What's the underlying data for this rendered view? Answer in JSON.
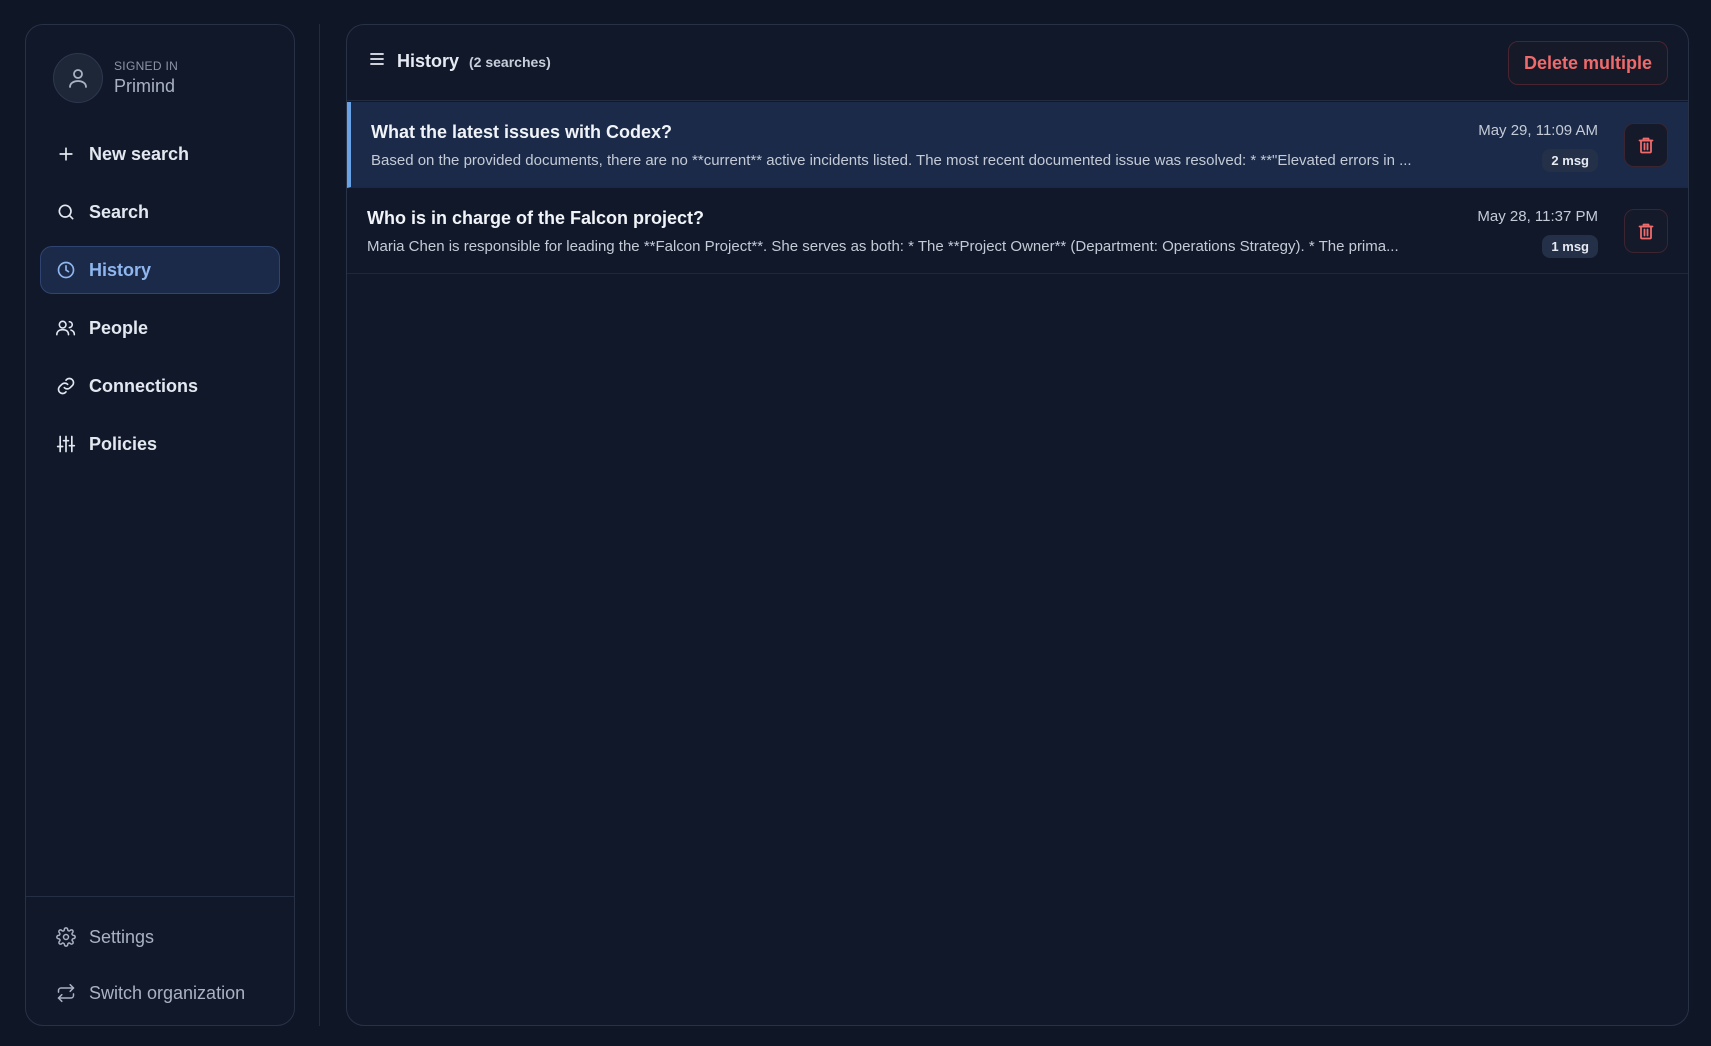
{
  "user": {
    "status_label": "SIGNED IN",
    "name": "Primind",
    "avatar_icon": "user-icon"
  },
  "nav": {
    "items": [
      {
        "label": "New search",
        "icon": "plus-icon"
      },
      {
        "label": "Search",
        "icon": "search-icon"
      },
      {
        "label": "History",
        "icon": "clock-icon",
        "active": true
      },
      {
        "label": "People",
        "icon": "people-icon"
      },
      {
        "label": "Connections",
        "icon": "link-icon"
      },
      {
        "label": "Policies",
        "icon": "sliders-icon"
      }
    ],
    "bottom": [
      {
        "label": "Settings",
        "icon": "gear-icon"
      },
      {
        "label": "Switch organization",
        "icon": "switch-icon"
      }
    ]
  },
  "history": {
    "title": "History",
    "count": "(2 searches)",
    "delete_multiple_label": "Delete multiple",
    "items": [
      {
        "title": "What the latest issues with Codex?",
        "snippet": "Based on the provided documents, there are no **current** active incidents listed. The most recent documented issue was resolved: * **\"Elevated errors in ...",
        "date": "May 29, 11:09 AM",
        "badge": "2 msg",
        "selected": true
      },
      {
        "title": "Who is in charge of the Falcon project?",
        "snippet": "Maria Chen is responsible for leading the **Falcon Project**. She serves as both: * The **Project Owner** (Department: Operations Strategy). * The prima...",
        "date": "May 28, 11:37 PM",
        "badge": "1 msg",
        "selected": false
      }
    ]
  },
  "colors": {
    "background": "#0f1626",
    "panel": "#111829",
    "active_nav": "#1b2a48",
    "accent": "#6aa2e6",
    "danger": "#ef6b6b"
  }
}
